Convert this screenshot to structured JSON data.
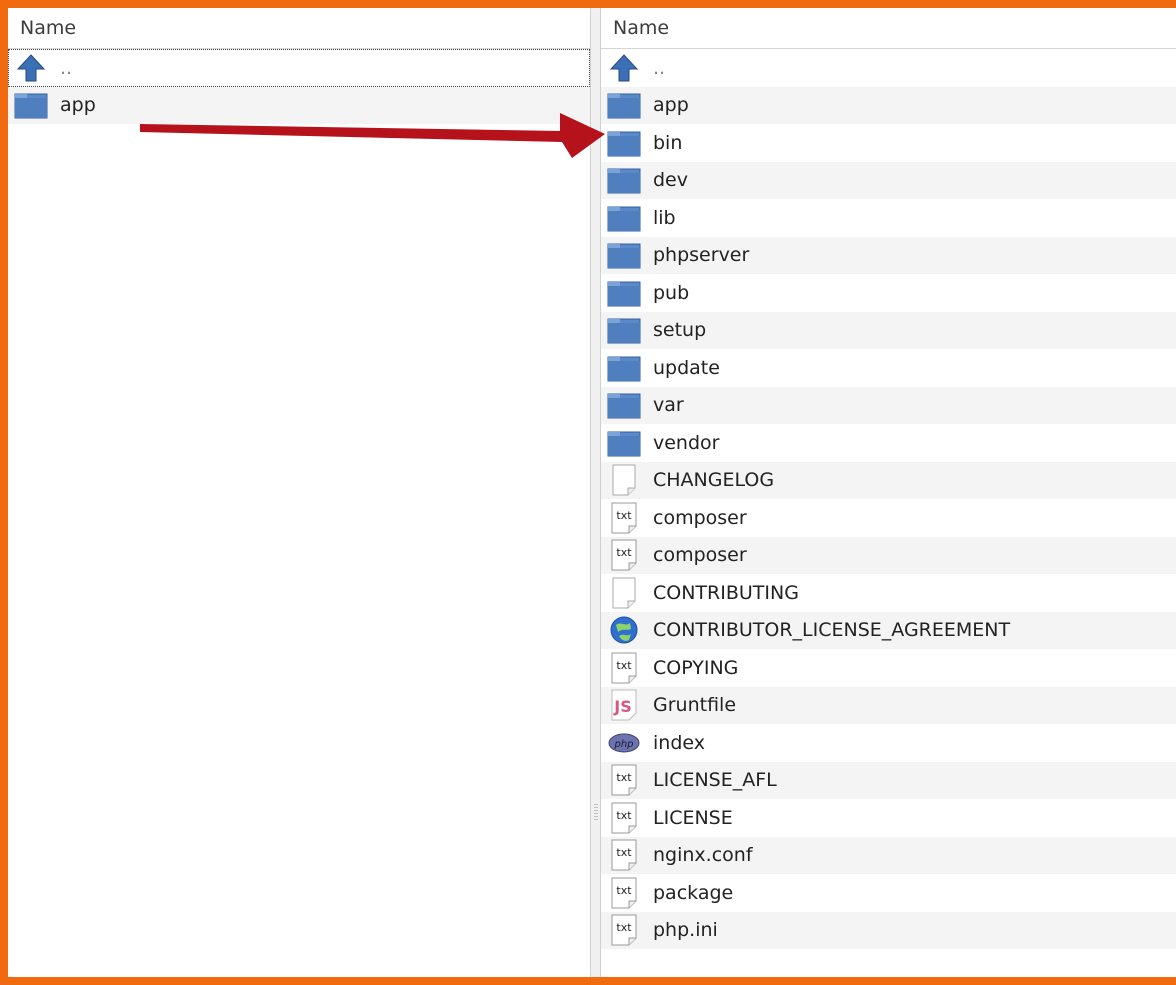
{
  "left_panel": {
    "column_header": "Name",
    "items": [
      {
        "name": "..",
        "icon": "up-arrow-icon"
      },
      {
        "name": "app",
        "icon": "folder-icon"
      }
    ]
  },
  "right_panel": {
    "column_header": "Name",
    "items": [
      {
        "name": "..",
        "icon": "up-arrow-icon"
      },
      {
        "name": "app",
        "icon": "folder-icon"
      },
      {
        "name": "bin",
        "icon": "folder-icon"
      },
      {
        "name": "dev",
        "icon": "folder-icon"
      },
      {
        "name": "lib",
        "icon": "folder-icon"
      },
      {
        "name": "phpserver",
        "icon": "folder-icon"
      },
      {
        "name": "pub",
        "icon": "folder-icon"
      },
      {
        "name": "setup",
        "icon": "folder-icon"
      },
      {
        "name": "update",
        "icon": "folder-icon"
      },
      {
        "name": "var",
        "icon": "folder-icon"
      },
      {
        "name": "vendor",
        "icon": "folder-icon"
      },
      {
        "name": "CHANGELOG",
        "icon": "blank-file-icon"
      },
      {
        "name": "composer",
        "icon": "txt-file-icon"
      },
      {
        "name": "composer",
        "icon": "txt-file-icon"
      },
      {
        "name": "CONTRIBUTING",
        "icon": "blank-file-icon"
      },
      {
        "name": "CONTRIBUTOR_LICENSE_AGREEMENT",
        "icon": "globe-file-icon"
      },
      {
        "name": "COPYING",
        "icon": "txt-file-icon"
      },
      {
        "name": "Gruntfile",
        "icon": "js-file-icon"
      },
      {
        "name": "index",
        "icon": "php-file-icon"
      },
      {
        "name": "LICENSE_AFL",
        "icon": "txt-file-icon"
      },
      {
        "name": "LICENSE",
        "icon": "txt-file-icon"
      },
      {
        "name": "nginx.conf",
        "icon": "txt-file-icon"
      },
      {
        "name": "package",
        "icon": "txt-file-icon"
      },
      {
        "name": "php.ini",
        "icon": "txt-file-icon"
      }
    ]
  },
  "colors": {
    "frame_border": "#f26a10",
    "annotation_arrow": "#b5121b",
    "folder": "#4f7fbf"
  }
}
